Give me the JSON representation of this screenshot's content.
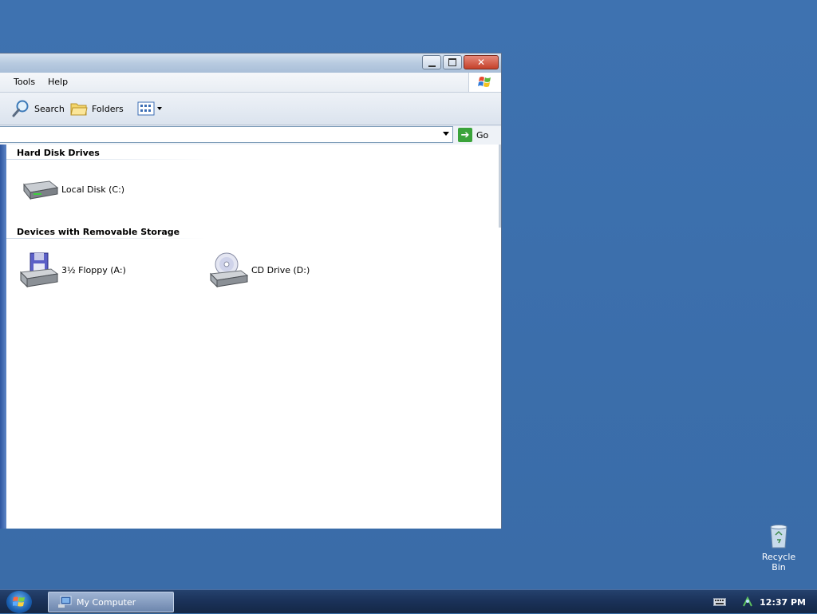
{
  "window": {
    "menus": [
      "Tools",
      "Help"
    ],
    "toolbar": {
      "search_label": "Search",
      "folders_label": "Folders"
    },
    "address": {
      "value": "",
      "go_label": "Go"
    },
    "groups": [
      {
        "title": "Hard Disk Drives",
        "items": [
          {
            "label": "Local Disk (C:)",
            "icon": "hard-disk-icon"
          }
        ]
      },
      {
        "title": "Devices with Removable Storage",
        "items": [
          {
            "label": "3½ Floppy (A:)",
            "icon": "floppy-drive-icon"
          },
          {
            "label": "CD Drive (D:)",
            "icon": "cd-drive-icon"
          }
        ]
      }
    ]
  },
  "taskbar": {
    "task_label": "My Computer",
    "clock": "12:37 PM"
  },
  "desktop": {
    "icons": [
      {
        "label": "Recycle Bin",
        "icon": "recycle-bin-icon"
      }
    ]
  },
  "colors": {
    "desktop": "#3b6eab",
    "taskbar": "#1a3158",
    "window_chrome": "#dfe6ef"
  }
}
